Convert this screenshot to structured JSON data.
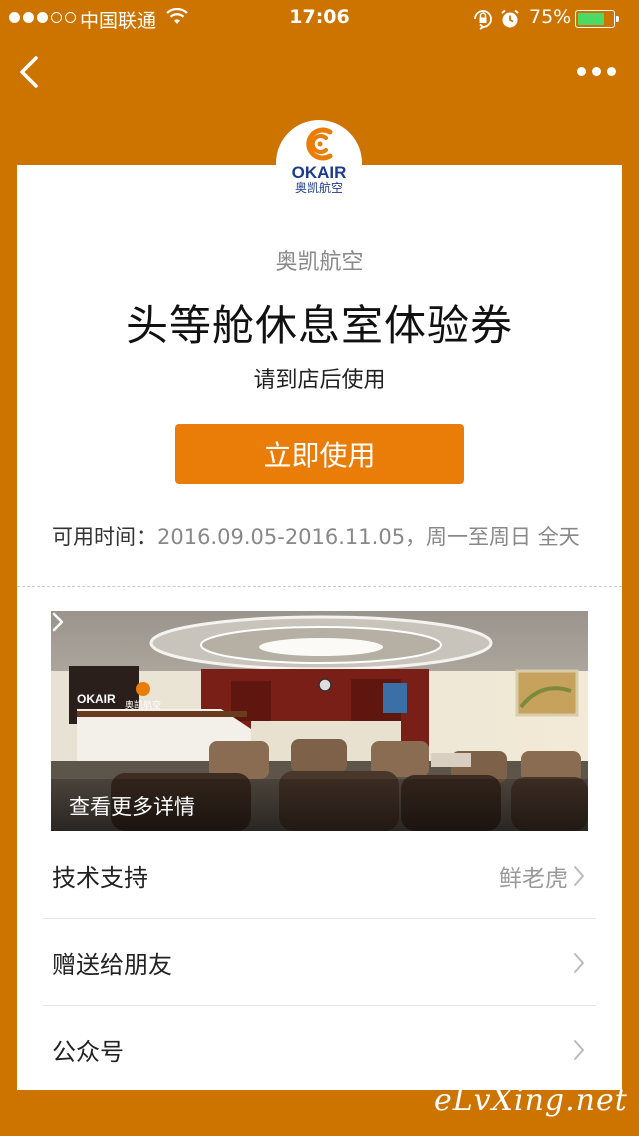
{
  "status_bar": {
    "carrier": "中国联通",
    "time": "17:06",
    "battery_percent": "75%",
    "battery_level": 0.75,
    "signal_bars_filled": 3,
    "signal_bars_total": 5
  },
  "nav": {
    "back_icon": "chevron-left-icon",
    "more_icon": "more-horizontal-icon"
  },
  "logo": {
    "brand_text": "OKAIR",
    "brand_sub": "奥凯航空",
    "brand_color": "#1D3B8F",
    "accent_color": "#EA7C08"
  },
  "coupon": {
    "merchant": "奥凯航空",
    "title": "头等舱休息室体验券",
    "hint": "请到店后使用",
    "use_button_label": "立即使用",
    "valid_label": "可用时间：",
    "valid_value": "2016.09.05-2016.11.05，周一至周日 全天"
  },
  "photo": {
    "caption": "查看更多详情",
    "sign_text": "OKAIR",
    "sign_sub": "奥凯航空"
  },
  "list": [
    {
      "label": "技术支持",
      "value": "鲜老虎"
    },
    {
      "label": "赠送给朋友",
      "value": ""
    },
    {
      "label": "公众号",
      "value": ""
    }
  ],
  "watermark": "eLvXing.net",
  "colors": {
    "background": "#CD7400",
    "button": "#EA7C08",
    "battery_fill": "#4CD964"
  }
}
